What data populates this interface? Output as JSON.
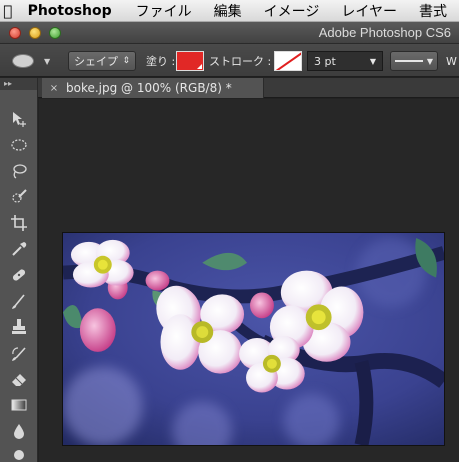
{
  "menubar": {
    "apple_icon": "apple-icon",
    "app_name": "Photoshop",
    "items": [
      "ファイル",
      "編集",
      "イメージ",
      "レイヤー",
      "書式"
    ]
  },
  "window": {
    "title": "Adobe Photoshop CS6"
  },
  "options_bar": {
    "tool_preset_icon": "ellipse-icon",
    "mode": "シェイプ",
    "fill_label": "塗り :",
    "fill_color": "#e12826",
    "stroke_label": "ストローク :",
    "stroke_color": "none",
    "stroke_width": "3 pt",
    "truncated_label": "W"
  },
  "tools": [
    "move-tool-icon",
    "elliptical-marquee-icon",
    "lasso-icon",
    "quick-selection-icon",
    "crop-icon",
    "eyedropper-icon",
    "healing-brush-icon",
    "brush-icon",
    "clone-stamp-icon",
    "history-brush-icon",
    "eraser-icon",
    "gradient-icon",
    "blur-icon",
    "dodge-icon"
  ],
  "document_tab": {
    "title": "boke.jpg @ 100% (RGB/8) *"
  },
  "colors": {
    "ui_dark": "#535353",
    "canvas_bg": "#272727",
    "fill_red": "#e12826"
  }
}
